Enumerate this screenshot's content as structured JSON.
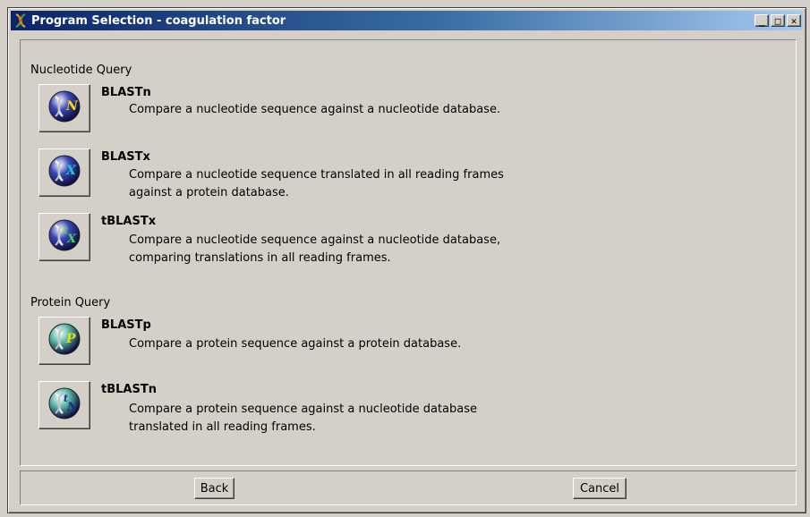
{
  "window": {
    "title": "Program Selection - coagulation factor",
    "minimize_glyph": "_",
    "maximize_glyph": "□",
    "close_glyph": "✕"
  },
  "sections": {
    "nucleotide_label": "Nucleotide Query",
    "protein_label": "Protein Query"
  },
  "programs": [
    {
      "name": "BLASTn",
      "description": "Compare a nucleotide sequence against a nucleotide database.",
      "icon": "dna-n-icon",
      "letters": "N",
      "letter_color": "#ffd700",
      "disc_color": "#3848b8"
    },
    {
      "name": "BLASTx",
      "description": "Compare a nucleotide sequence translated in all reading frames\nagainst a protein database.",
      "icon": "dna-x-icon",
      "letters": "X",
      "letter_color": "#22c7c7",
      "disc_color": "#3848b8"
    },
    {
      "name": "tBLASTx",
      "description": "Compare a nucleotide sequence against a nucleotide database,\ncomparing translations in all reading frames.",
      "icon": "dna-tx-icon",
      "letters": "tX",
      "letter_color": "#4fd24f",
      "disc_color": "#3848b8"
    },
    {
      "name": "BLASTp",
      "description": "Compare a protein sequence against a protein database.",
      "icon": "protein-p-icon",
      "letters": "P",
      "letter_color": "#e0e000",
      "disc_color": "#58b8a8"
    },
    {
      "name": "tBLASTn",
      "description": "Compare a protein sequence against a nucleotide database\ntranslated in all reading frames.",
      "icon": "protein-tn-icon",
      "letters": "tN",
      "letter_color": "#1a2a8a",
      "disc_color": "#58b8a8"
    }
  ],
  "footer": {
    "back_label": "Back",
    "cancel_label": "Cancel"
  }
}
